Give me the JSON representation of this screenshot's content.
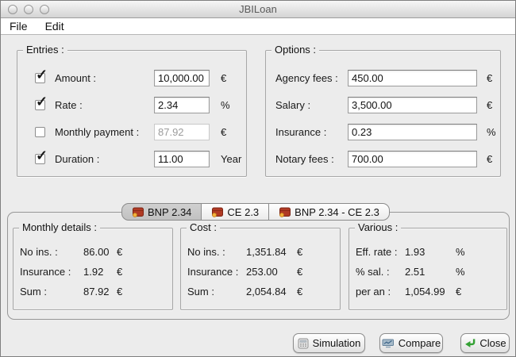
{
  "window": {
    "title": "JBILoan"
  },
  "menu": {
    "items": [
      "File",
      "Edit"
    ]
  },
  "entries": {
    "title": "Entries :",
    "rows": [
      {
        "checked": true,
        "enabled": true,
        "label": "Amount :",
        "value": "10,000.00",
        "unit": "€"
      },
      {
        "checked": true,
        "enabled": true,
        "label": "Rate :",
        "value": "2.34",
        "unit": "%"
      },
      {
        "checked": false,
        "enabled": false,
        "label": "Monthly payment :",
        "value": "87.92",
        "unit": "€"
      },
      {
        "checked": true,
        "enabled": true,
        "label": "Duration :",
        "value": "11.00",
        "unit": "Year"
      }
    ]
  },
  "options": {
    "title": "Options :",
    "rows": [
      {
        "label": "Agency fees :",
        "value": "450.00",
        "unit": "€"
      },
      {
        "label": "Salary :",
        "value": "3,500.00",
        "unit": "€"
      },
      {
        "label": "Insurance :",
        "value": "0.23",
        "unit": "%"
      },
      {
        "label": "Notary fees :",
        "value": "700.00",
        "unit": "€"
      }
    ]
  },
  "tabs": [
    {
      "label": "BNP 2.34",
      "icon": "wallet-icon",
      "selected": true
    },
    {
      "label": "CE 2.3",
      "icon": "wallet-icon",
      "selected": false
    },
    {
      "label": "BNP 2.34 - CE 2.3",
      "icon": "wallet-icon",
      "selected": false
    }
  ],
  "results": {
    "monthly": {
      "title": "Monthly details :",
      "rows": [
        {
          "label": "No ins. :",
          "value": "86.00",
          "unit": "€"
        },
        {
          "label": "Insurance :",
          "value": "1.92",
          "unit": "€"
        },
        {
          "label": "Sum :",
          "value": "87.92",
          "unit": "€"
        }
      ]
    },
    "cost": {
      "title": "Cost :",
      "rows": [
        {
          "label": "No ins. :",
          "value": "1,351.84",
          "unit": "€"
        },
        {
          "label": "Insurance :",
          "value": "253.00",
          "unit": "€"
        },
        {
          "label": "Sum :",
          "value": "2,054.84",
          "unit": "€"
        }
      ]
    },
    "various": {
      "title": "Various :",
      "rows": [
        {
          "label": "Eff. rate :",
          "value": "1.93",
          "unit": "%"
        },
        {
          "label": "% sal. :",
          "value": "2.51",
          "unit": "%"
        },
        {
          "label": "per an :",
          "value": "1,054.99",
          "unit": "€"
        }
      ]
    }
  },
  "footer": {
    "buttons": [
      {
        "label": "Simulation",
        "icon": "calculator-icon"
      },
      {
        "label": "Compare",
        "icon": "compare-icon"
      },
      {
        "label": "Close",
        "icon": "return-arrow-icon"
      }
    ]
  },
  "colors": {
    "wallet_red": "#b03a24",
    "coin_gold": "#f2b13c",
    "close_green": "#35a135",
    "window_bg": "#ececec"
  }
}
